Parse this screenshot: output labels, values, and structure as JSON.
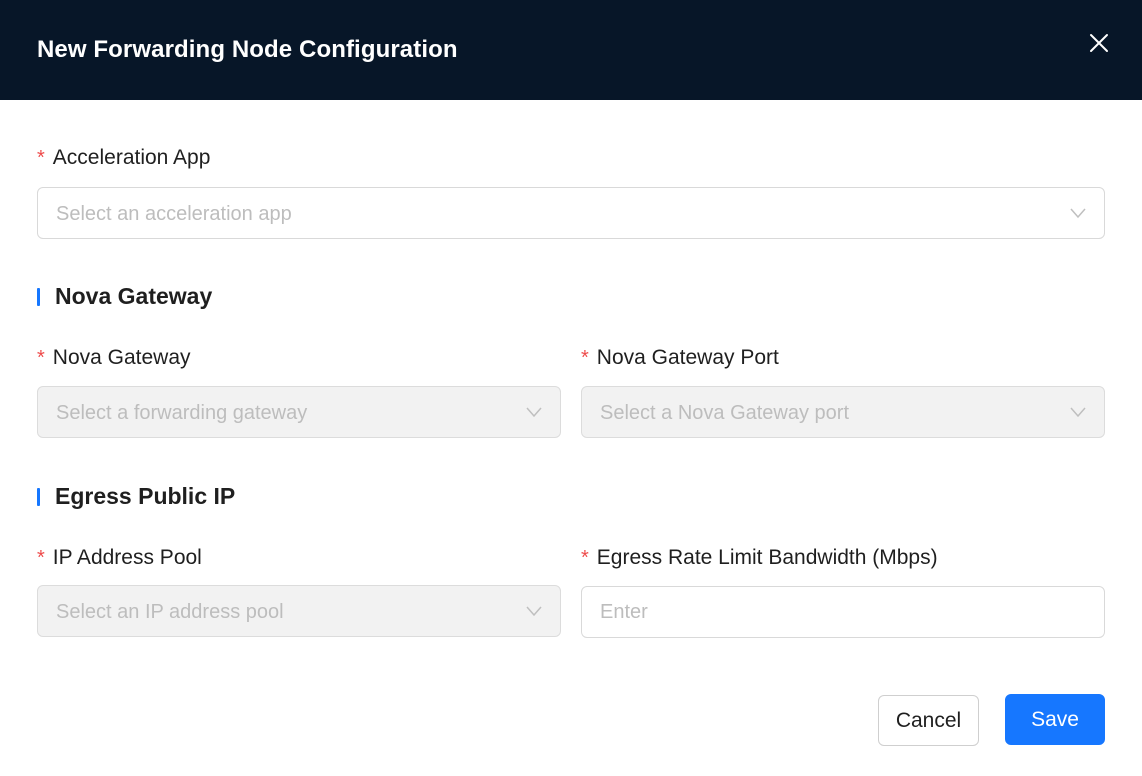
{
  "dialog": {
    "title": "New Forwarding Node Configuration",
    "close_icon": "close-icon"
  },
  "acceleration_app": {
    "required_mark": "*",
    "label": "Acceleration App",
    "placeholder": "Select an acceleration app"
  },
  "nova_section": {
    "title": "Nova Gateway",
    "gateway": {
      "required_mark": "*",
      "label": "Nova Gateway",
      "placeholder": "Select a forwarding gateway",
      "disabled": true
    },
    "port": {
      "required_mark": "*",
      "label": "Nova Gateway Port",
      "placeholder": "Select a Nova Gateway port",
      "disabled": true
    }
  },
  "egress_section": {
    "title": "Egress Public IP",
    "ip_pool": {
      "required_mark": "*",
      "label": "IP Address Pool",
      "placeholder": "Select an IP address pool",
      "disabled": true
    },
    "bandwidth": {
      "required_mark": "*",
      "label": "Egress Rate Limit Bandwidth (Mbps)",
      "placeholder": "Enter",
      "value": ""
    }
  },
  "footer": {
    "cancel_label": "Cancel",
    "save_label": "Save"
  },
  "colors": {
    "header_bg": "#071628",
    "accent": "#1677ff",
    "required": "#ee4b4b",
    "disabled_bg": "#f2f2f2"
  }
}
